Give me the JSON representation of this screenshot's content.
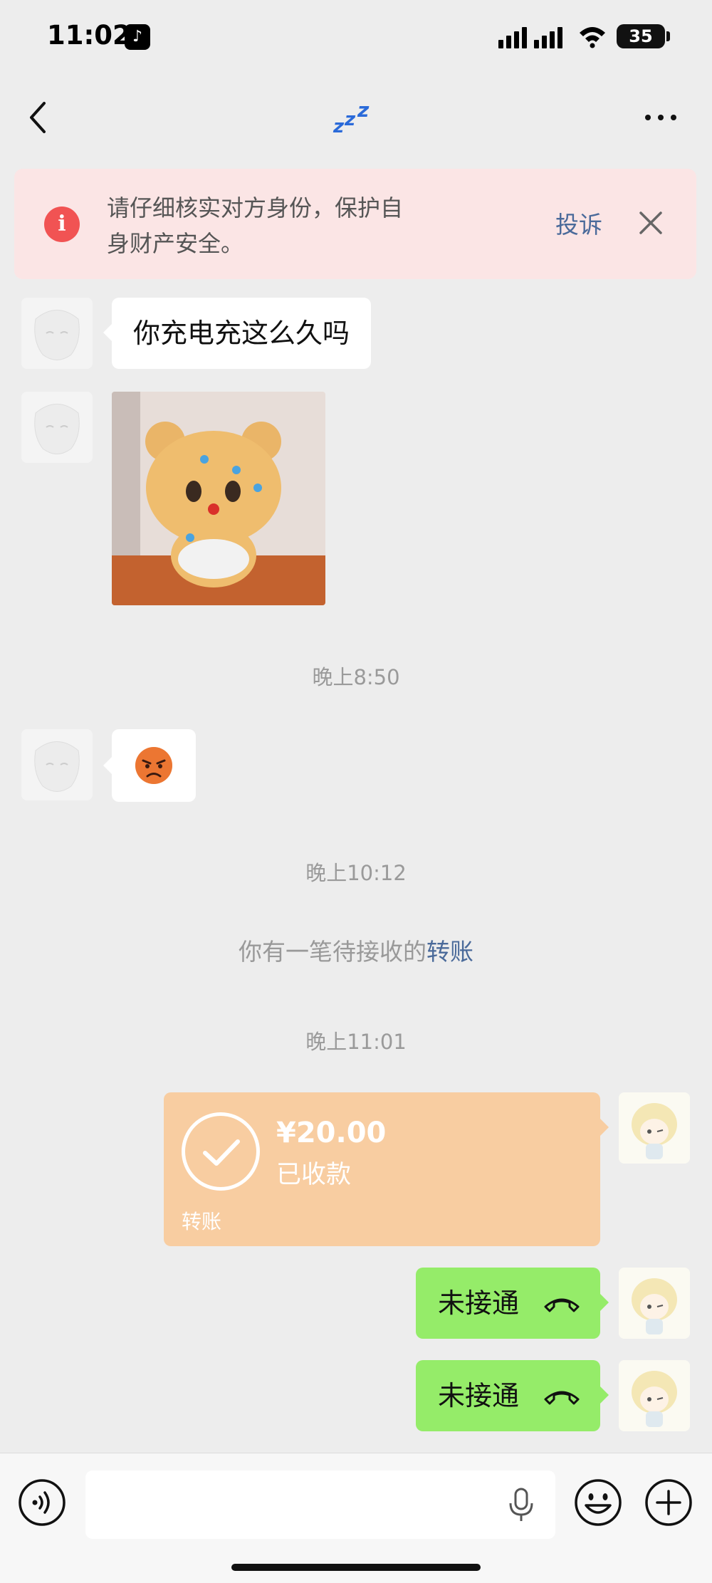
{
  "status_bar": {
    "time": "11:02",
    "battery": "35",
    "icons": [
      "tiktok-icon",
      "signal-icon",
      "wifi-icon",
      "battery-icon"
    ]
  },
  "nav": {
    "title": "zzz",
    "back_icon": "chevron-left-icon",
    "more_icon": "more-dots-icon"
  },
  "banner": {
    "text": "请仔细核实对方身份，保护自身财产安全。",
    "complain": "投诉",
    "icon": "info-icon",
    "close_icon": "close-icon"
  },
  "messages": {
    "text1": "你充电充这么久吗",
    "sticker": "bear-sticker",
    "emoji": "angry-face-emoji"
  },
  "timestamps": {
    "t1": "晚上8:50",
    "t2": "晚上10:12",
    "t3": "晚上11:01"
  },
  "system": {
    "prefix": "你有一笔待接收的",
    "link": "转账"
  },
  "transfer": {
    "amount": "¥20.00",
    "status": "已收款",
    "label": "转账",
    "color": "#f8cda1"
  },
  "calls": [
    {
      "text": "未接通"
    },
    {
      "text": "未接通"
    }
  ],
  "input_bar": {
    "placeholder": "",
    "icons": [
      "voice-icon",
      "mic-icon",
      "emoji-icon",
      "plus-icon"
    ]
  },
  "colors": {
    "background": "#ededed",
    "self_bubble": "#95ec69",
    "link": "#4a6a9a",
    "alert": "#f15353"
  }
}
